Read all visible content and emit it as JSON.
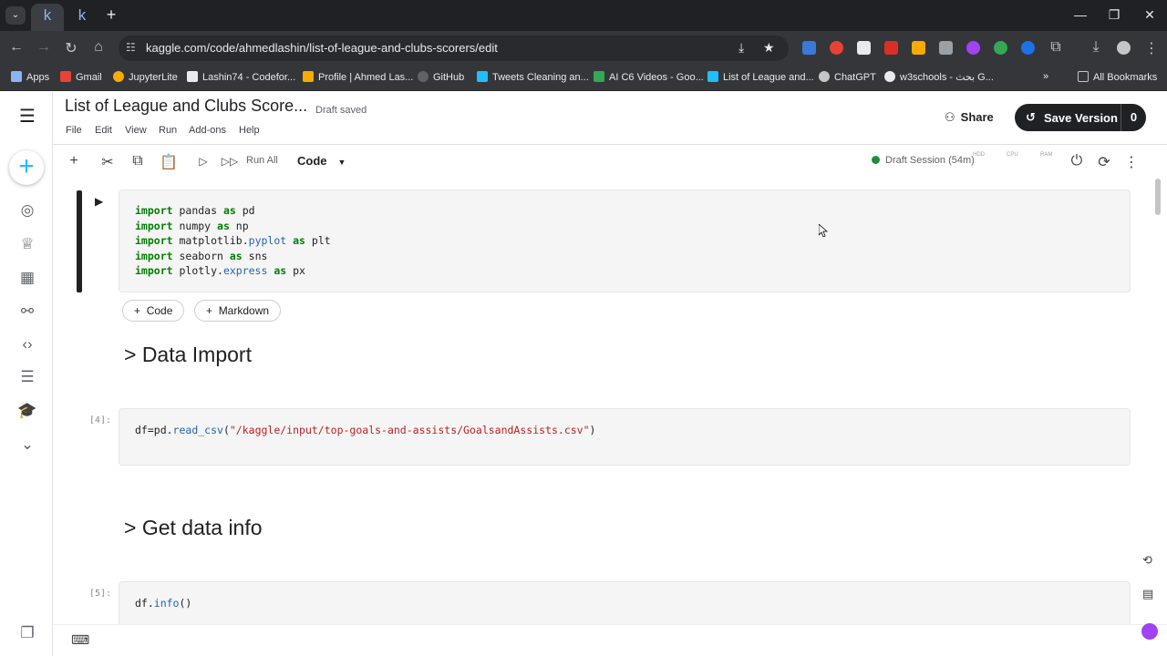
{
  "browser": {
    "tabs": [
      {
        "favicon": "k"
      },
      {
        "favicon": "k"
      }
    ],
    "url": "kaggle.com/code/ahmedlashin/list-of-league-and-clubs-scorers/edit",
    "bookmarks": [
      {
        "label": "Apps",
        "color": "#8ab4f8"
      },
      {
        "label": "Gmail",
        "color": "#ea4335"
      },
      {
        "label": "JupyterLite",
        "color": "#f9ab00"
      },
      {
        "label": "Lashin74 - Codefor...",
        "color": "#e8eaed"
      },
      {
        "label": "Profile | Ahmed Las...",
        "color": "#f9ab00"
      },
      {
        "label": "GitHub",
        "color": "#202124"
      },
      {
        "label": "Tweets Cleaning an...",
        "color": "#20beff"
      },
      {
        "label": "AI C6 Videos - Goo...",
        "color": "#34a853"
      },
      {
        "label": "List of League and...",
        "color": "#20beff"
      },
      {
        "label": "ChatGPT",
        "color": "#c4c7c5"
      },
      {
        "label": "w3schools - بحث G...",
        "color": "#e8eaed"
      }
    ],
    "all_bookmarks": "All Bookmarks"
  },
  "notebook": {
    "title": "List of League and Clubs Score...",
    "status": "Draft saved",
    "menu": [
      "File",
      "Edit",
      "View",
      "Run",
      "Add-ons",
      "Help"
    ],
    "share": "Share",
    "save_version": "Save Version",
    "version_count": "0",
    "run_all": "Run All",
    "cell_type": "Code",
    "session": "Draft Session (54m)",
    "meters": [
      "HDD",
      "CPU",
      "RAM"
    ]
  },
  "cells": {
    "c1_count": "",
    "add_code": "Code",
    "add_markdown": "Markdown",
    "h1": "> Data Import",
    "c2_count": "[4]:",
    "h2": "> Get data info",
    "c3_count": "[5]:"
  }
}
